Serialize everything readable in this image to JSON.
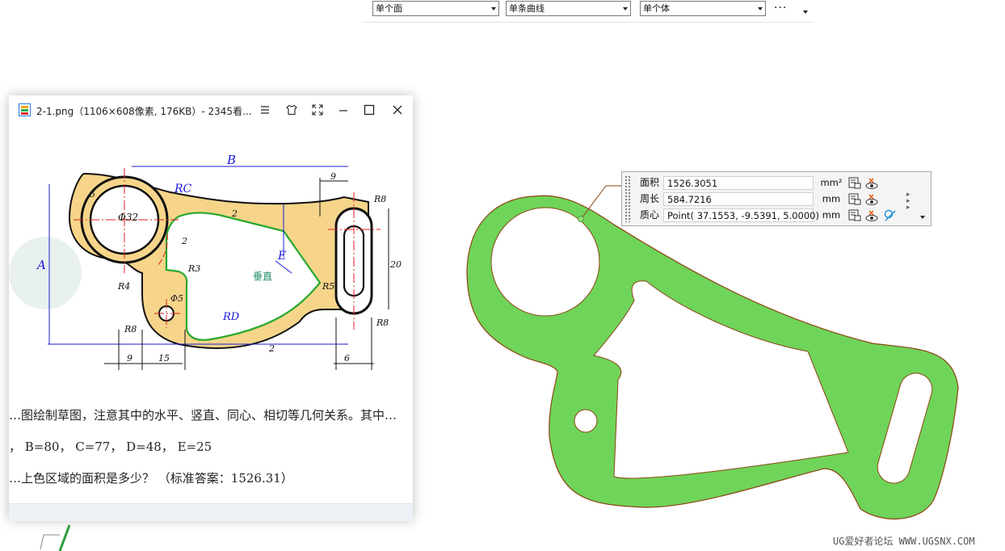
{
  "toolbar": {
    "face_filter": "单个面",
    "curve_filter": "单条曲线",
    "body_filter": "单个体",
    "more_label": "···"
  },
  "viewer": {
    "title": "2-1.png（1106×608像素, 176KB）- 2345看...",
    "icons": [
      "menu-icon",
      "skin-icon",
      "fullscreen-icon",
      "minimize-icon",
      "maximize-icon",
      "close-icon"
    ]
  },
  "drawing": {
    "dims": {
      "B": "B",
      "RC": "RC",
      "dia32": "Φ32",
      "r5a": "5",
      "A": "A",
      "R4": "R4",
      "dia5": "Φ5",
      "R3": "R3",
      "R8a": "R8",
      "d9": "9",
      "d15": "15",
      "RD": "RD",
      "d2a": "2",
      "d2b": "2",
      "d2c": "2",
      "E": "E",
      "vertical": "垂直",
      "R5": "R5",
      "R8b": "R8",
      "d9b": "9",
      "d20": "20",
      "R8c": "R8",
      "d6": "6"
    },
    "line1": "…图绘制草图，注意其中的水平、竖直、同心、相切等几何关系。其中…",
    "line2": "， B=80， C=77， D=48， E=25",
    "line3": "…上色区域的面积是多少？ （标准答案：1526.31）"
  },
  "measure": {
    "rows": [
      {
        "label": "面积",
        "value": "1526.3051",
        "unit": "mm²"
      },
      {
        "label": "周长",
        "value": "584.7216",
        "unit": "mm"
      },
      {
        "label": "质心",
        "value": "Point( 37.1553, -9.5391, 5.0000)",
        "unit": "mm"
      }
    ]
  },
  "watermark": "UG爱好者论坛 WWW.UGSNX.COM",
  "colors": {
    "part_fill": "#6fd45a",
    "part_edge": "#8b4513",
    "drawing_fill": "#f6d58a",
    "dim_blue": "#1b1bd8",
    "center_red": "#e02020"
  }
}
